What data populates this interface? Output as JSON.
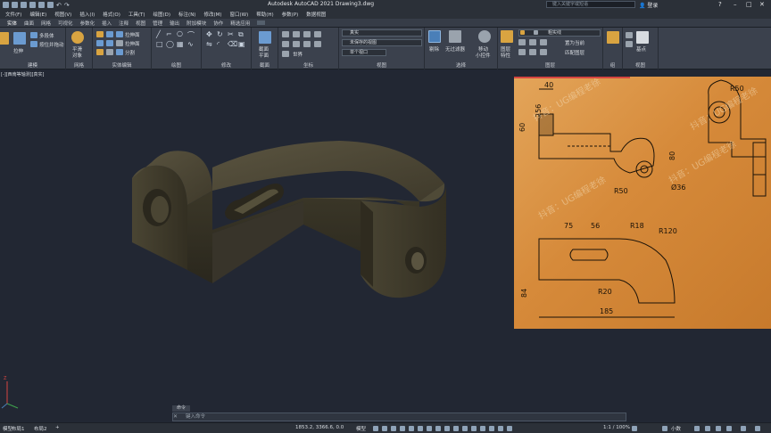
{
  "window": {
    "title": "Autodesk AutoCAD 2021    Drawing3.dwg",
    "search_placeholder": "键入关键字或短语",
    "login_label": "登录"
  },
  "menu": {
    "items": [
      "文件(F)",
      "编辑(E)",
      "视图(V)",
      "插入(I)",
      "格式(O)",
      "工具(T)",
      "绘图(D)",
      "标注(N)",
      "修改(M)",
      "窗口(W)",
      "帮助(H)",
      "参数(P)",
      "数据视图"
    ]
  },
  "ribbon_tabs": {
    "items": [
      "实体",
      "曲面",
      "网格",
      "可视化",
      "参数化",
      "插入",
      "注释",
      "视图",
      "管理",
      "输出",
      "附加模块",
      "协作",
      "精选应用"
    ]
  },
  "ribbon": {
    "panels": {
      "modeling": {
        "label": "建模",
        "extrude": "拉伸",
        "polysolid": "多段体",
        "presspull": "按住并拖动"
      },
      "mesh": {
        "label": "网格",
        "smooth_object": "平滑",
        "smooth_object2": "对象"
      },
      "solid_edit": {
        "label": "实体编辑",
        "extrude_face": "拉伸面",
        "separate": "分割"
      },
      "draw": {
        "label": "绘图"
      },
      "modify": {
        "label": "修改"
      },
      "section": {
        "label": "截面",
        "plane": "截面",
        "plane2": "平面"
      },
      "coordinates": {
        "label": "坐标",
        "world": "世界"
      },
      "view": {
        "label": "视图",
        "visual_style": "真实",
        "named_view": "未保存的视图",
        "unsaved": "单个视口"
      },
      "selection": {
        "label": "选择",
        "cull": "剔除",
        "nofilter": "无过滤器",
        "move_gizmo": "移动",
        "move_gizmo2": "小控件"
      },
      "layers": {
        "label": "图层",
        "layer_props": "图层",
        "layer_props2": "特性",
        "layer_name": "粗实线",
        "make_current": "置为当前",
        "match": "匹配图层"
      },
      "groups": {
        "label": "组"
      },
      "views": {
        "label": "视图",
        "base": "基点"
      }
    }
  },
  "viewport": {
    "label": "[-][西南等轴测][真实]",
    "watermark": "抖音：UG编程老徐"
  },
  "drawing": {
    "dims": {
      "d40": "40",
      "d60": "60",
      "d256": "256",
      "d80": "80",
      "r50a": "R50",
      "r50b": "R50",
      "d36": "Ø36",
      "d75": "75",
      "d56": "56",
      "r18": "R18",
      "r120": "R120",
      "r20": "R20",
      "d84": "84",
      "d185": "185"
    }
  },
  "command": {
    "history_label": "命令",
    "placeholder": "键入命令"
  },
  "status": {
    "layout_model": "模型",
    "layout1": "布局1",
    "layout2": "布局2",
    "coords": "1853.2, 3366.6, 0.0",
    "model_mode": "模型",
    "scale": "1:1 / 100%",
    "decimal": "小数"
  },
  "colors": {
    "accent_red": "#d64541",
    "part_color": "#3e3a2c"
  }
}
